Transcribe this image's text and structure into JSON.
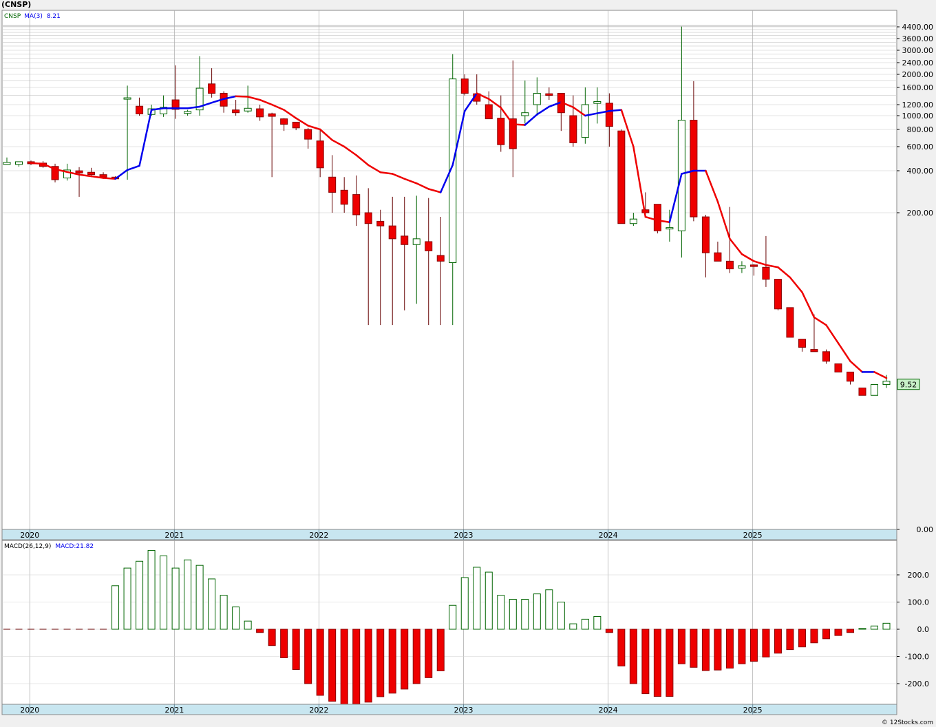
{
  "header": {
    "title": "(CNSP)"
  },
  "footer": {
    "credit": "© 12Stocks.com"
  },
  "price_legend": {
    "ticker": "CNSP",
    "ma_label": "MA(3)",
    "ma_value": "8.21"
  },
  "macd_legend": {
    "label": "MACD(26,12,9)",
    "value": "MACD:21.82"
  },
  "last_price_tag": "9.52",
  "colors": {
    "up": "#006400",
    "down": "#ee0000",
    "ma_up": "#0000ee",
    "ma_down": "#ee0000",
    "grid": "#b4b4b4",
    "axis_band": "#c8e6f0"
  },
  "chart_data": [
    {
      "type": "candlestick",
      "scale": "log",
      "y_ticks": [
        "4400.00",
        "3600.00",
        "3000.00",
        "2400.00",
        "2000.00",
        "1600.00",
        "1200.00",
        "1000.00",
        "800.00",
        "600.00",
        "400.00",
        "200.00",
        "0.00"
      ],
      "x_labels": [
        "2020",
        "2021",
        "2022",
        "2023",
        "2024",
        "2025"
      ],
      "series_name": "CNSP",
      "ohlc": [
        [
          450,
          500,
          450,
          455
        ],
        [
          450,
          465,
          428,
          460
        ],
        [
          460,
          475,
          440,
          455
        ],
        [
          455,
          470,
          420,
          430
        ],
        [
          430,
          450,
          330,
          345
        ],
        [
          355,
          450,
          340,
          405
        ],
        [
          395,
          425,
          260,
          390
        ],
        [
          390,
          420,
          370,
          375
        ],
        [
          375,
          390,
          350,
          360
        ],
        [
          360,
          365,
          345,
          350
        ],
        [
          1330,
          1650,
          345,
          1330
        ],
        [
          1170,
          1350,
          1000,
          1030
        ],
        [
          1020,
          1200,
          1000,
          1120
        ],
        [
          1030,
          1400,
          980,
          1150
        ],
        [
          1300,
          2300,
          950,
          1110
        ],
        [
          1050,
          1100,
          1000,
          1060
        ],
        [
          1100,
          2700,
          1000,
          1580
        ],
        [
          1700,
          2200,
          1350,
          1450
        ],
        [
          1450,
          1500,
          1050,
          1170
        ],
        [
          1100,
          1300,
          1000,
          1050
        ],
        [
          1080,
          1650,
          1050,
          1130
        ],
        [
          1120,
          1200,
          920,
          980
        ],
        [
          1020,
          1050,
          360,
          1000
        ],
        [
          950,
          960,
          780,
          870
        ],
        [
          900,
          900,
          790,
          820
        ],
        [
          800,
          820,
          580,
          680
        ],
        [
          660,
          800,
          360,
          420
        ],
        [
          360,
          520,
          200,
          280
        ],
        [
          290,
          360,
          200,
          230
        ],
        [
          270,
          370,
          170,
          195
        ],
        [
          200,
          300,
          50,
          175
        ],
        [
          180,
          210,
          50,
          170
        ],
        [
          170,
          260,
          50,
          145
        ],
        [
          150,
          260,
          60,
          135
        ],
        [
          135,
          265,
          65,
          145
        ],
        [
          140,
          255,
          50,
          125
        ],
        [
          118,
          190,
          50,
          110
        ],
        [
          108,
          2800,
          50,
          1850
        ],
        [
          1850,
          2000,
          1400,
          1450
        ],
        [
          1440,
          2000,
          1200,
          1270
        ],
        [
          1200,
          1500,
          950,
          950
        ],
        [
          960,
          1400,
          550,
          620
        ],
        [
          950,
          2500,
          360,
          580
        ],
        [
          1000,
          1800,
          880,
          1050
        ],
        [
          1200,
          1900,
          1000,
          1450
        ],
        [
          1440,
          1600,
          1300,
          1400
        ],
        [
          1450,
          1450,
          780,
          1050
        ],
        [
          1000,
          1400,
          600,
          640
        ],
        [
          700,
          1600,
          630,
          1200
        ],
        [
          1240,
          1600,
          880,
          1250
        ],
        [
          1230,
          1450,
          600,
          840
        ],
        [
          780,
          800,
          175,
          175
        ],
        [
          175,
          200,
          170,
          185
        ],
        [
          210,
          280,
          190,
          200
        ],
        [
          230,
          230,
          155,
          160
        ],
        [
          165,
          210,
          140,
          165
        ],
        [
          160,
          4500,
          115,
          930
        ],
        [
          930,
          1780,
          180,
          190
        ],
        [
          190,
          195,
          90,
          122
        ],
        [
          122,
          140,
          110,
          110
        ],
        [
          110,
          220,
          95,
          100
        ],
        [
          101,
          110,
          95,
          104
        ],
        [
          105,
          106,
          92,
          103
        ],
        [
          102,
          150,
          80,
          88
        ],
        [
          88,
          88,
          60,
          61
        ],
        [
          62,
          62,
          43,
          43
        ],
        [
          42,
          42,
          36,
          38
        ],
        [
          37,
          57,
          36,
          36
        ],
        [
          36,
          37,
          31,
          32
        ],
        [
          31,
          31,
          28,
          28
        ],
        [
          28,
          28,
          24,
          25
        ],
        [
          23,
          23,
          21,
          21
        ],
        [
          21,
          24,
          21,
          24
        ],
        [
          24,
          27,
          23,
          25
        ]
      ],
      "ma_values": [
        null,
        null,
        455,
        450,
        410,
        392,
        375,
        365,
        355,
        350,
        405,
        435,
        1100,
        1130,
        1130,
        1130,
        1160,
        1240,
        1320,
        1380,
        1370,
        1300,
        1200,
        1100,
        960,
        850,
        800,
        670,
        600,
        520,
        440,
        390,
        380,
        350,
        325,
        296,
        280,
        440,
        1080,
        1450,
        1320,
        1140,
        870,
        860,
        1020,
        1160,
        1250,
        1150,
        1000,
        1040,
        1080,
        1100,
        600,
        190,
        182,
        178,
        380,
        400,
        400,
        240,
        145,
        120,
        110,
        105,
        102,
        90,
        75,
        55,
        50,
        40,
        32,
        28,
        28,
        26
      ]
    },
    {
      "type": "bar",
      "y_ticks": [
        "200.0",
        "100.0",
        "0.0",
        "-100.0",
        "-200.0"
      ],
      "ylim": [
        -280,
        290
      ],
      "values": [
        0,
        0,
        0,
        0,
        0,
        0,
        0,
        0,
        0,
        160,
        225,
        250,
        290,
        270,
        225,
        255,
        235,
        185,
        125,
        82,
        30,
        -12,
        -60,
        -105,
        -148,
        -200,
        -243,
        -265,
        -278,
        -275,
        -268,
        -248,
        -235,
        -220,
        -200,
        -178,
        -153,
        88,
        190,
        228,
        210,
        125,
        110,
        110,
        130,
        145,
        100,
        20,
        37,
        47,
        -12,
        -135,
        -200,
        -237,
        -247,
        -247,
        -127,
        -140,
        -152,
        -150,
        -143,
        -127,
        -118,
        -102,
        -88,
        -75,
        -65,
        -50,
        -35,
        -23,
        -12,
        3,
        12,
        22
      ]
    }
  ]
}
